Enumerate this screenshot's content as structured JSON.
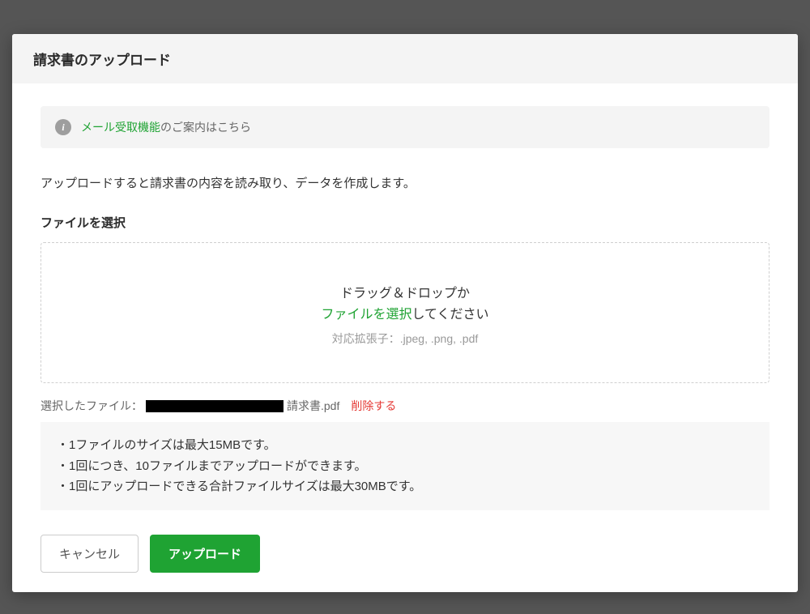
{
  "modal": {
    "title": "請求書のアップロード",
    "info": {
      "link_text": "メール受取機能",
      "rest_text": "のご案内はこちら"
    },
    "description": "アップロードすると請求書の内容を読み取り、データを作成します。",
    "file_section_label": "ファイルを選択",
    "dropzone": {
      "line1": "ドラッグ＆ドロップか",
      "line2_green": "ファイルを選択",
      "line2_rest": "してください",
      "ext_hint": "対応拡張子：.jpeg, .png, .pdf"
    },
    "selected": {
      "label": "選択したファイル：",
      "filename_suffix": "請求書.pdf",
      "delete": "削除する"
    },
    "rules": [
      "・1ファイルのサイズは最大15MBです。",
      "・1回につき、10ファイルまでアップロードができます。",
      "・1回にアップロードできる合計ファイルサイズは最大30MBです。"
    ],
    "footer": {
      "cancel": "キャンセル",
      "upload": "アップロード"
    }
  }
}
